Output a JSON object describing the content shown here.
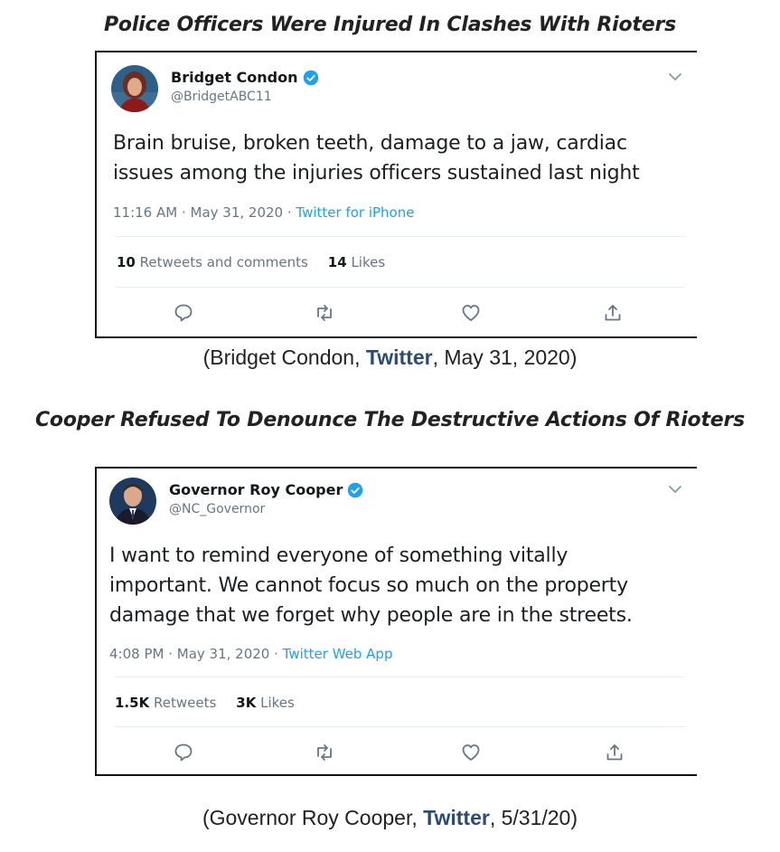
{
  "sections": [
    {
      "heading": "Police Officers Were Injured In Clashes With Rioters",
      "tweet": {
        "name": "Bridget Condon",
        "handle": "@BridgetABC11",
        "text_lines": [
          "Brain bruise, broken teeth, damage to a jaw, cardiac",
          "issues among the injuries officers sustained last night"
        ],
        "time": "11:16 AM",
        "date": "May 31, 2020",
        "source": "Twitter for iPhone",
        "stat1_count": "10",
        "stat1_label": "Retweets and comments",
        "stat2_count": "14",
        "stat2_label": "Likes"
      },
      "caption": {
        "prefix": "(Bridget Condon, ",
        "link": "Twitter",
        "suffix": ", May 31, 2020)"
      }
    },
    {
      "heading": "Cooper Refused To Denounce The Destructive Actions Of Rioters",
      "tweet": {
        "name": "Governor Roy Cooper",
        "handle": "@NC_Governor",
        "text_lines": [
          "I want to remind everyone of something vitally",
          "important. We cannot focus so much on the property",
          "damage that we forget why people are in the streets."
        ],
        "time": "4:08 PM",
        "date": "May 31, 2020",
        "source": "Twitter Web App",
        "stat1_count": "1.5K",
        "stat1_label": "Retweets",
        "stat2_count": "3K",
        "stat2_label": "Likes"
      },
      "caption": {
        "prefix": "(Governor Roy Cooper, ",
        "link": "Twitter",
        "suffix": ", 5/31/20)"
      }
    }
  ],
  "separator": " · ",
  "icons": [
    "verified-badge-icon",
    "chevron-down-icon",
    "reply-icon",
    "retweet-icon",
    "like-icon",
    "share-icon"
  ],
  "colors": {
    "link_blue": "#2a4a78",
    "twitter_blue": "#1da1f2",
    "secondary_gray": "#657786",
    "border": "#111111"
  }
}
